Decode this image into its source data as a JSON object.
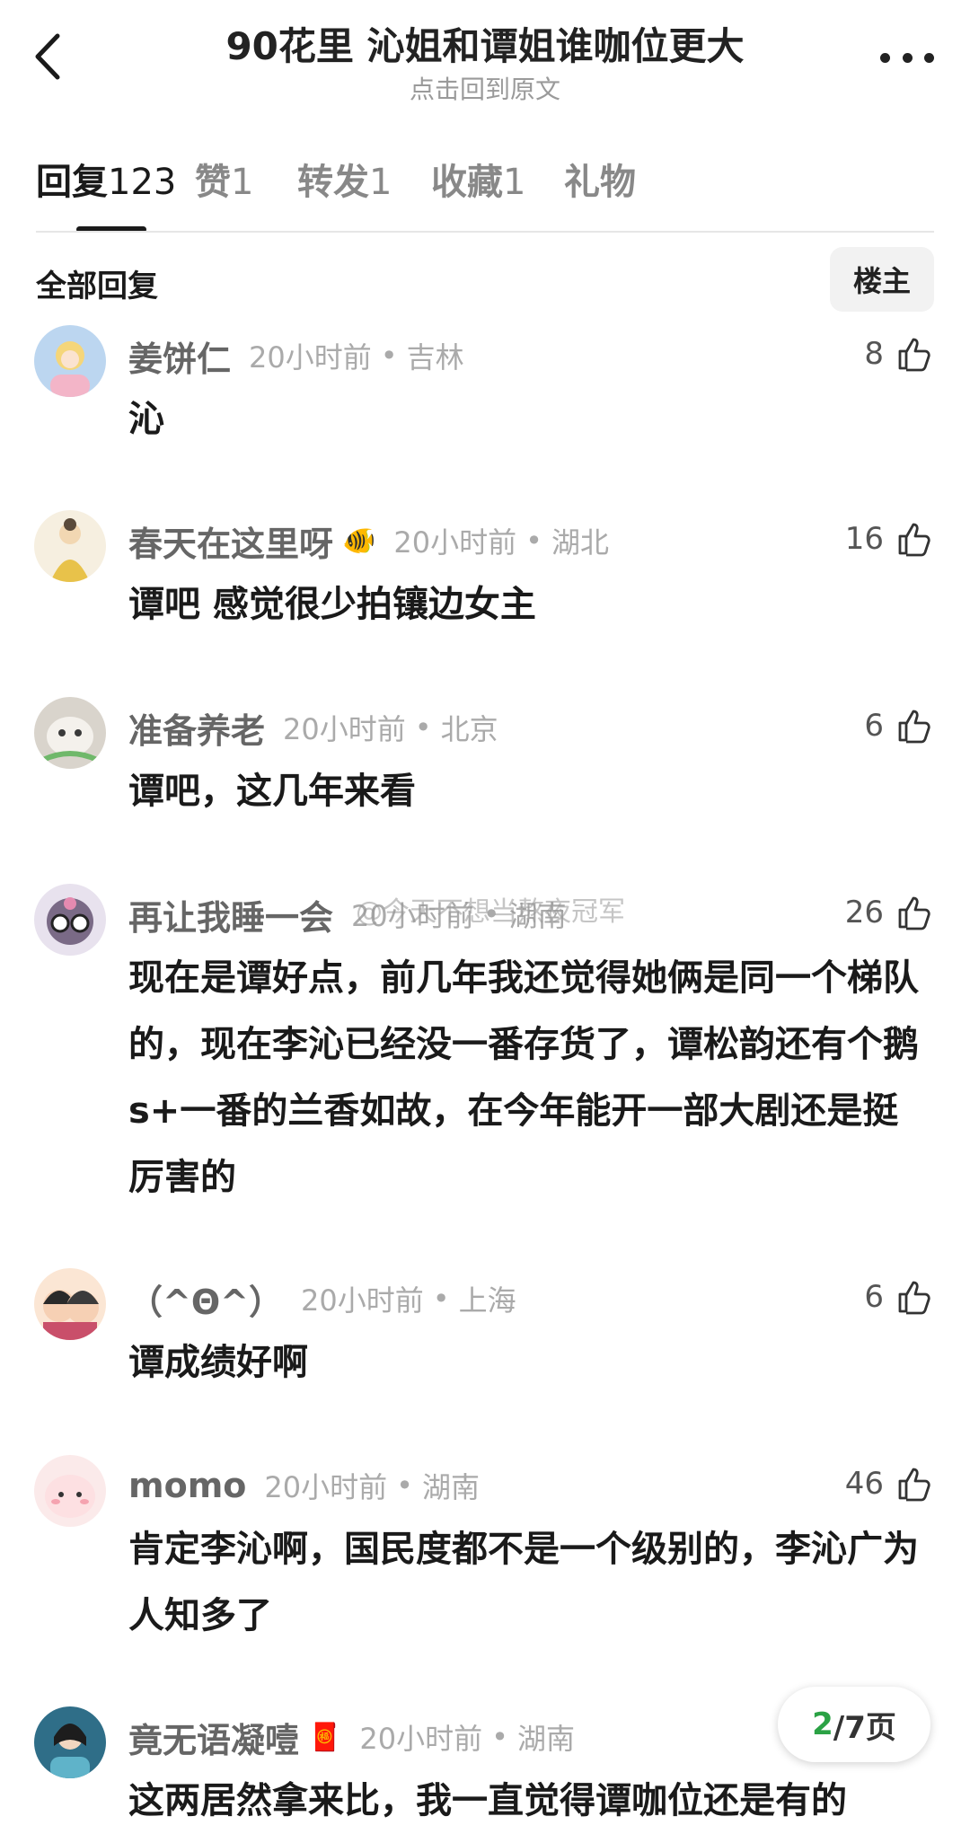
{
  "header": {
    "title": "90花里 沁姐和谭姐谁咖位更大",
    "subtitle": "点击回到原文"
  },
  "tabs": [
    {
      "label": "回复",
      "count": "123"
    },
    {
      "label": "赞",
      "count": "1"
    },
    {
      "label": "转发",
      "count": "1"
    },
    {
      "label": "收藏",
      "count": "1"
    },
    {
      "label": "礼物",
      "count": ""
    }
  ],
  "section": {
    "title": "全部回复",
    "op_button": "楼主"
  },
  "comments": [
    {
      "user": "姜饼仁",
      "badge": "",
      "time": "20小时前",
      "location": "吉林",
      "likes": "8",
      "text": "沁"
    },
    {
      "user": "春天在这里呀",
      "badge": "🐠",
      "time": "20小时前",
      "location": "湖北",
      "likes": "16",
      "text": "谭吧 感觉很少拍镶边女主"
    },
    {
      "user": "准备养老",
      "badge": "",
      "time": "20小时前",
      "location": "北京",
      "likes": "6",
      "text": "谭吧，这几年来看"
    },
    {
      "user": "再让我睡一会",
      "badge": "",
      "time": "20小时前",
      "location": "湖南",
      "likes": "26",
      "text": "现在是谭好点，前几年我还觉得她俩是同一个梯队的，现在李沁已经没一番存货了，谭松韵还有个鹅s+一番的兰香如故，在今年能开一部大剧还是挺厉害的"
    },
    {
      "user": "（^Θ^）",
      "badge": "",
      "time": "20小时前",
      "location": "上海",
      "likes": "6",
      "text": "谭成绩好啊"
    },
    {
      "user": "momo",
      "badge": "",
      "time": "20小时前",
      "location": "湖南",
      "likes": "46",
      "text": "肯定李沁啊，国民度都不是一个级别的，李沁广为人知多了"
    },
    {
      "user": "竟无语凝噎",
      "badge": "🧧",
      "time": "20小时前",
      "location": "湖南",
      "likes": "",
      "text": "这两居然拿来比，我一直觉得谭咖位还是有的"
    }
  ],
  "watermark": "@今天不想当熬夜冠军",
  "pager": {
    "current": "2",
    "total": "/7页"
  },
  "colors": {
    "accent": "#2ba245",
    "text": "#1a1a1a",
    "muted": "#aaaaaa"
  }
}
